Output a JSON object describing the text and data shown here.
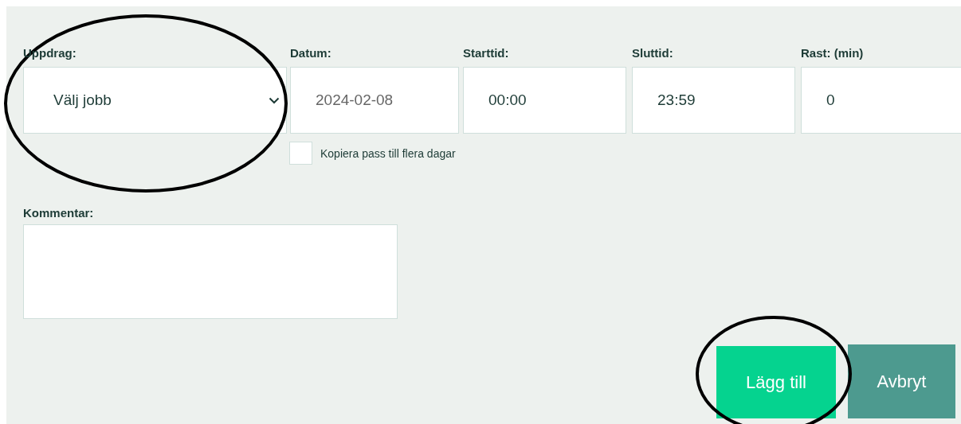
{
  "fields": [
    {
      "kind": "select",
      "label": "Uppdrag:",
      "value": "Välj jobb"
    },
    {
      "kind": "date",
      "label": "Datum:",
      "value": "2024-02-08"
    },
    {
      "kind": "time",
      "label": "Starttid:",
      "value": "00:00"
    },
    {
      "kind": "time",
      "label": "Sluttid:",
      "value": "23:59"
    },
    {
      "kind": "number",
      "label": "Rast: (min)",
      "value": "0"
    }
  ],
  "copy_checkbox": {
    "label": "Kopiera pass till flera dagar",
    "checked": false
  },
  "comment": {
    "label": "Kommentar:"
  },
  "buttons": [
    {
      "kind": "primary",
      "label": "Lägg till"
    },
    {
      "kind": "secondary",
      "label": "Avbryt"
    }
  ]
}
